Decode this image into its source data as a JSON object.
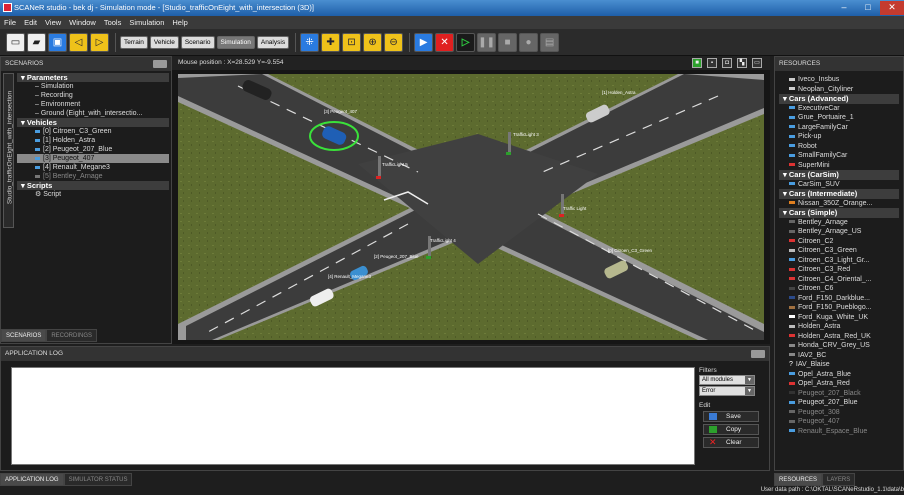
{
  "window": {
    "title": "SCANeR studio - bek dj - Simulation mode - [Studio_trafficOnEight_with_intersection (3D)]"
  },
  "menu": [
    "File",
    "Edit",
    "View",
    "Window",
    "Tools",
    "Simulation",
    "Help"
  ],
  "toolbar": {
    "modes": [
      "Terrain",
      "Vehicle",
      "Scenario",
      "Simulation",
      "Analysis"
    ],
    "active_mode": "Simulation"
  },
  "scenarios": {
    "header": "SCENARIOS",
    "side_tab": "Studio_trafficOnEight_with_intersection",
    "parameters_label": "Parameters",
    "parameters": [
      "Simulation",
      "Recording",
      "Environment",
      "Ground (Eight_with_intersectio..."
    ],
    "vehicles_label": "Vehicles",
    "vehicles": [
      "[0] Citroen_C3_Green",
      "[1] Holden_Astra",
      "[2] Peugeot_207_Blue",
      "[3] Peugeot_407",
      "[4] Renault_Megane3",
      "[5] Bentley_Arnage"
    ],
    "scripts_label": "Scripts",
    "scripts": [
      "Script"
    ],
    "tabs": [
      "SCENARIOS",
      "RECORDINGS"
    ]
  },
  "viewport": {
    "mouse_label": "Mouse position :",
    "mouse_x": "X=28.529",
    "mouse_y": "Y=-9.554",
    "labels": [
      "[3] Peugeot_407",
      "[1] Holden_Astra",
      "TrafficLight 3",
      "TrafficLight 5",
      "Traffic Light",
      "TrafficLight 4",
      "[2] Peugeot_207_Blue",
      "[4] Renault_Megane3",
      "[0] Citroen_C3_Green"
    ]
  },
  "log": {
    "header": "APPLICATION LOG",
    "filters_label": "Filters",
    "filter_module": "All modules",
    "filter_level": "Error",
    "edit_label": "Edit",
    "save": "Save",
    "copy": "Copy",
    "clear": "Clear",
    "tabs": [
      "APPLICATION LOG",
      "SIMULATOR STATUS"
    ]
  },
  "resources": {
    "header": "RESOURCES",
    "top_items": [
      "Iveco_Insbus",
      "Neoplan_Cityliner"
    ],
    "cars_advanced_label": "Cars (Advanced)",
    "cars_advanced": [
      "ExecutiveCar",
      "Grue_Portuaire_1",
      "LargeFamilyCar",
      "Pick-up",
      "Robot",
      "SmallFamilyCar",
      "SuperMini"
    ],
    "cars_carsim_label": "Cars (CarSim)",
    "cars_carsim": [
      "CarSim_SUV"
    ],
    "cars_intermediate_label": "Cars (Intermediate)",
    "cars_intermediate": [
      "Nissan_350Z_Orange..."
    ],
    "cars_simple_label": "Cars (Simple)",
    "cars_simple": [
      "Bentley_Arnage",
      "Bentley_Arnage_US",
      "Citroen_C2",
      "Citroen_C3_Green",
      "Citroen_C3_Light_Gr...",
      "Citroen_C3_Red",
      "Citroen_C4_Oriental_...",
      "Citroen_C6",
      "Ford_F150_Darkblue...",
      "Ford_F150_Pueblogo...",
      "Ford_Kuga_White_UK",
      "Holden_Astra",
      "Holden_Astra_Red_UK",
      "Honda_CRV_Grey_US",
      "IAV2_BC",
      "IAV_Blaise",
      "Opel_Astra_Blue",
      "Opel_Astra_Red",
      "Peugeot_207_Black",
      "Peugeot_207_Blue",
      "Peugeot_308",
      "Peugeot_407",
      "Renault_Espace_Blue"
    ],
    "tabs": [
      "RESOURCES",
      "LAYERS"
    ]
  },
  "status": {
    "path": "User data path : C:\\OKTAL\\SCANeRstudio_1.1\\data\\b"
  }
}
